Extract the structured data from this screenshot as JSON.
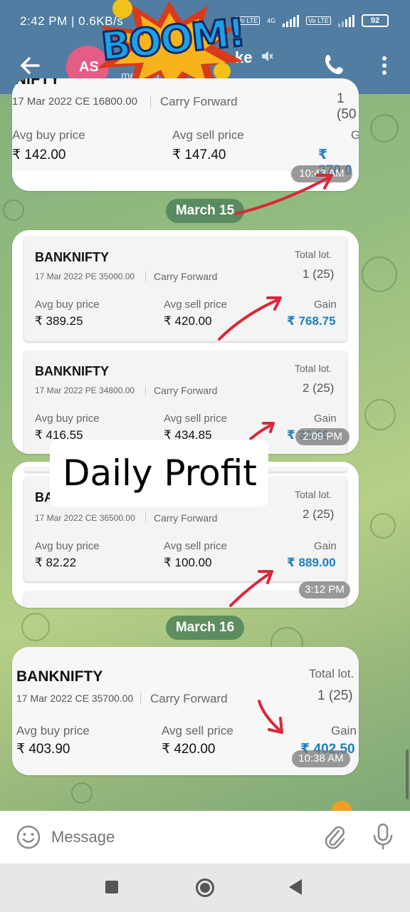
{
  "status": {
    "time": "2:42 PM | 0.6KB/s",
    "battery": "92",
    "lte1": "Vo LTE",
    "lte2": "Vo LTE",
    "net": "4G"
  },
  "header": {
    "avatar_initials": "AS",
    "title": "ke",
    "subtitle": "members"
  },
  "sticker": {
    "text": "BOOM!"
  },
  "overlay_text": "Daily Profit",
  "labels": {
    "total_lot": "Total lot.",
    "avg_buy": "Avg buy price",
    "avg_sell": "Avg sell price",
    "gain": "Gain",
    "carry": "Carry Forward"
  },
  "messages": [
    {
      "date_before": null,
      "cards": [
        {
          "symbol": "NIFTY",
          "contract": "17 Mar 2022 CE 16800.00",
          "lots": "1 (50",
          "buy": "₹ 142.00",
          "sell": "₹ 147.40",
          "gain": "₹ 270.0"
        }
      ],
      "time": "10:43 AM"
    },
    {
      "date_before": "March 15",
      "cards": [
        {
          "symbol": "BANKNIFTY",
          "contract": "17 Mar 2022 PE 35000.00",
          "lots": "1 (25)",
          "buy": "₹ 389.25",
          "sell": "₹ 420.00",
          "gain": "₹ 768.75"
        },
        {
          "symbol": "BANKNIFTY",
          "contract": "17 Mar 2022 PE 34800.00",
          "lots": "2 (25)",
          "buy": "₹ 416.55",
          "sell": "₹ 434.85",
          "gain": "₹ 36.60"
        }
      ],
      "time": "2:09 PM"
    },
    {
      "date_before": null,
      "cards": [
        {
          "symbol": "BANKNIFTY",
          "contract": "17 Mar 2022 CE 36500.00",
          "lots": "2 (25)",
          "buy": "₹ 82.22",
          "sell": "₹ 100.00",
          "gain": "₹ 889.00"
        }
      ],
      "time": "3:12 PM"
    },
    {
      "date_before": "March 16",
      "cards": [
        {
          "symbol": "BANKNIFTY",
          "contract": "17 Mar 2022 CE 35700.00",
          "lots": "1 (25)",
          "buy": "₹ 403.90",
          "sell": "₹ 420.00",
          "gain": "₹ 402.50"
        }
      ],
      "time": "10:38 AM"
    }
  ],
  "composer": {
    "placeholder": "Message"
  },
  "colors": {
    "header": "#517da2",
    "gain": "#1d7fbf",
    "arrow": "#d8283a",
    "avatar": "#e35d87"
  }
}
